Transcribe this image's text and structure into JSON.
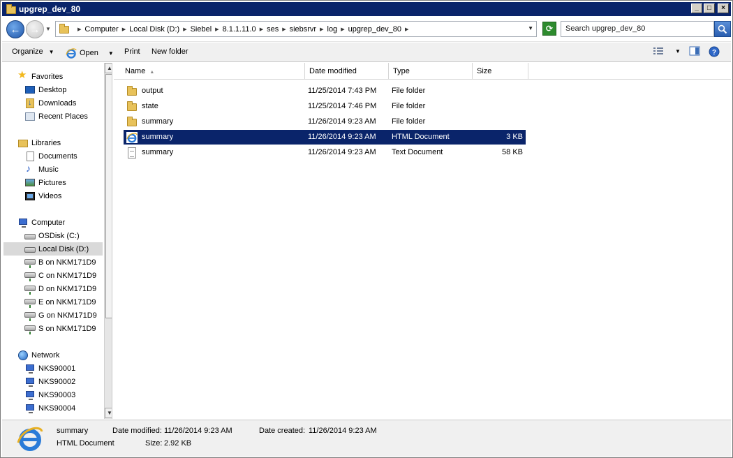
{
  "window": {
    "title": "upgrep_dev_80",
    "buttons": [
      "_",
      "□",
      "×"
    ]
  },
  "address": {
    "crumbs": [
      "Computer",
      "Local Disk (D:)",
      "Siebel",
      "8.1.1.11.0",
      "ses",
      "siebsrvr",
      "log",
      "upgrep_dev_80"
    ],
    "search_placeholder": "Search upgrep_dev_80"
  },
  "toolbar": {
    "organize": "Organize",
    "open": "Open",
    "print": "Print",
    "new_folder": "New folder"
  },
  "nav": {
    "favorites_header": "Favorites",
    "favorites": [
      "Desktop",
      "Downloads",
      "Recent Places"
    ],
    "libraries_header": "Libraries",
    "libraries": [
      "Documents",
      "Music",
      "Pictures",
      "Videos"
    ],
    "computer_header": "Computer",
    "computer": [
      "OSDisk (C:)",
      "Local Disk (D:)",
      "B on NKM171D9",
      "C on NKM171D9",
      "D on NKM171D9",
      "E on NKM171D9",
      "G on NKM171D9",
      "S on NKM171D9"
    ],
    "network_header": "Network",
    "network": [
      "NKS90001",
      "NKS90002",
      "NKS90003",
      "NKS90004"
    ]
  },
  "columns": {
    "name": "Name",
    "date": "Date modified",
    "type": "Type",
    "size": "Size"
  },
  "files": [
    {
      "name": "output",
      "date": "11/25/2014 7:43 PM",
      "type": "File folder",
      "size": "",
      "icon": "folder-icon"
    },
    {
      "name": "state",
      "date": "11/25/2014 7:46 PM",
      "type": "File folder",
      "size": "",
      "icon": "folder-icon"
    },
    {
      "name": "summary",
      "date": "11/26/2014 9:23 AM",
      "type": "File folder",
      "size": "",
      "icon": "folder-icon"
    },
    {
      "name": "summary",
      "date": "11/26/2014 9:23 AM",
      "type": "HTML Document",
      "size": "3 KB",
      "icon": "internet-explorer-icon",
      "selected": true
    },
    {
      "name": "summary",
      "date": "11/26/2014 9:23 AM",
      "type": "Text Document",
      "size": "58 KB",
      "icon": "text-document-icon"
    }
  ],
  "details": {
    "name": "summary",
    "type": "HTML Document",
    "date_modified_label": "Date modified:",
    "date_modified": "11/26/2014 9:23 AM",
    "date_created_label": "Date created:",
    "date_created": "11/26/2014 9:23 AM",
    "size_label": "Size:",
    "size": "2.92 KB"
  },
  "colors": {
    "selection": "#0a246a",
    "titlebar": "#0a246a",
    "nav_selected": "#d9d9d9"
  }
}
